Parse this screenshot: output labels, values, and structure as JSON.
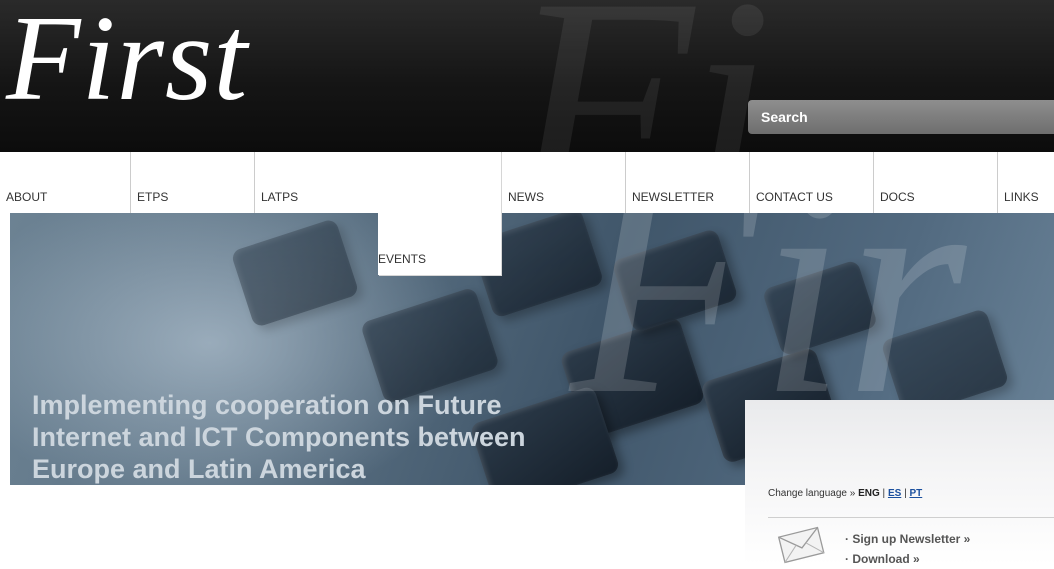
{
  "header": {
    "logo_text": "First",
    "search_placeholder": "Search"
  },
  "nav": {
    "items": [
      {
        "label": "ABOUT",
        "active": false
      },
      {
        "label": "ETPS",
        "active": false
      },
      {
        "label": "LATPS",
        "active": false
      },
      {
        "label": "EVENTS",
        "active": true
      },
      {
        "label": "NEWS",
        "active": false
      },
      {
        "label": "NEWSLETTER",
        "active": false
      },
      {
        "label": "CONTACT US",
        "active": false
      },
      {
        "label": "DOCS",
        "active": false
      },
      {
        "label": "LINKS",
        "active": false
      }
    ]
  },
  "hero": {
    "tagline_line1": "Implementing cooperation on Future",
    "tagline_line2": "Internet and ICT Components between",
    "tagline_line3": "Europe and Latin America"
  },
  "panel": {
    "change_language_label": "Change language »",
    "current_language": "ENG",
    "separator": "|",
    "lang_es": "ES",
    "lang_pt": "PT",
    "signup_link": "· Sign up Newsletter »",
    "download_link": "· Download »"
  },
  "colors": {
    "header_bg": "#151515",
    "link_blue": "#1a4f9e",
    "search_bg": "#7d7d7d"
  }
}
